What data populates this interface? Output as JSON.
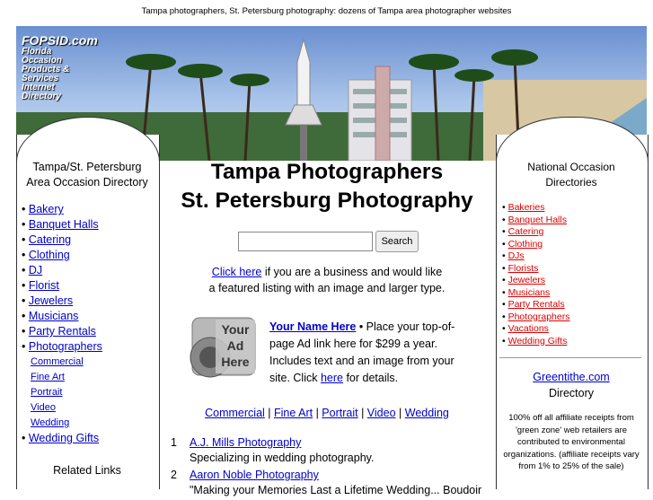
{
  "top_caption": "Tampa photographers, St. Petersburg photography: dozens of Tampa area photographer websites",
  "banner": {
    "logo_name": "FOPSID.com",
    "logo_tagline": [
      "Florida",
      "Occasion",
      "Products &",
      "Services",
      "Internet",
      "Directory"
    ]
  },
  "left": {
    "title_line1": "Tampa/St. Petersburg",
    "title_line2": "Area Occasion Directory",
    "items": [
      "Bakery",
      "Banquet Halls",
      "Catering",
      "Clothing",
      "DJ",
      "Florist",
      "Jewelers",
      "Musicians",
      "Party Rentals",
      "Photographers"
    ],
    "sub_items": [
      "Commercial",
      "Fine Art",
      "Portrait",
      "Video",
      "Wedding"
    ],
    "last_item": "Wedding Gifts",
    "related": "Related Links"
  },
  "main": {
    "title_line1": "Tampa Photographers",
    "title_line2": "St. Petersburg Photography",
    "search_value": "",
    "search_button": "Search",
    "promo_link": "Click here",
    "promo_text1": " if you are a business and would like",
    "promo_text2": "a featured listing with an image and larger type.",
    "ad_image_text": [
      "Your",
      "Ad",
      "Here"
    ],
    "ad_link": "Your Name Here",
    "ad_text1": " • Place your top-of-page Ad link here for $299 a year. Includes text and an image from your site. Click ",
    "ad_here": "here",
    "ad_text2": " for details.",
    "categories": [
      "Commercial",
      "Fine Art",
      "Portrait",
      "Video",
      "Wedding"
    ],
    "results": [
      {
        "num": "1",
        "name": "A.J. Mills Photography",
        "desc": "Specializing in wedding photography."
      },
      {
        "num": "2",
        "name": "Aaron Noble Photography",
        "desc": "\"Making your Memories Last a Lifetime Wedding... Boudoir"
      }
    ]
  },
  "right": {
    "title_line1": "National Occasion",
    "title_line2": "Directories",
    "items": [
      "Bakeries",
      "Banquet Halls",
      "Catering",
      "Clothing",
      "DJs",
      "Florists",
      "Jewelers",
      "Musicians",
      "Party Rentals",
      "Photographers",
      "Vacations",
      "Wedding Gifts"
    ],
    "green_link": "Greentithe.com",
    "green_sub": "Directory",
    "green_note": "100% off all affiliate receipts from 'green zone' web retailers are contributed to environmental organizations. (affiliate receipts vary from 1% to 25% of the sale)"
  }
}
